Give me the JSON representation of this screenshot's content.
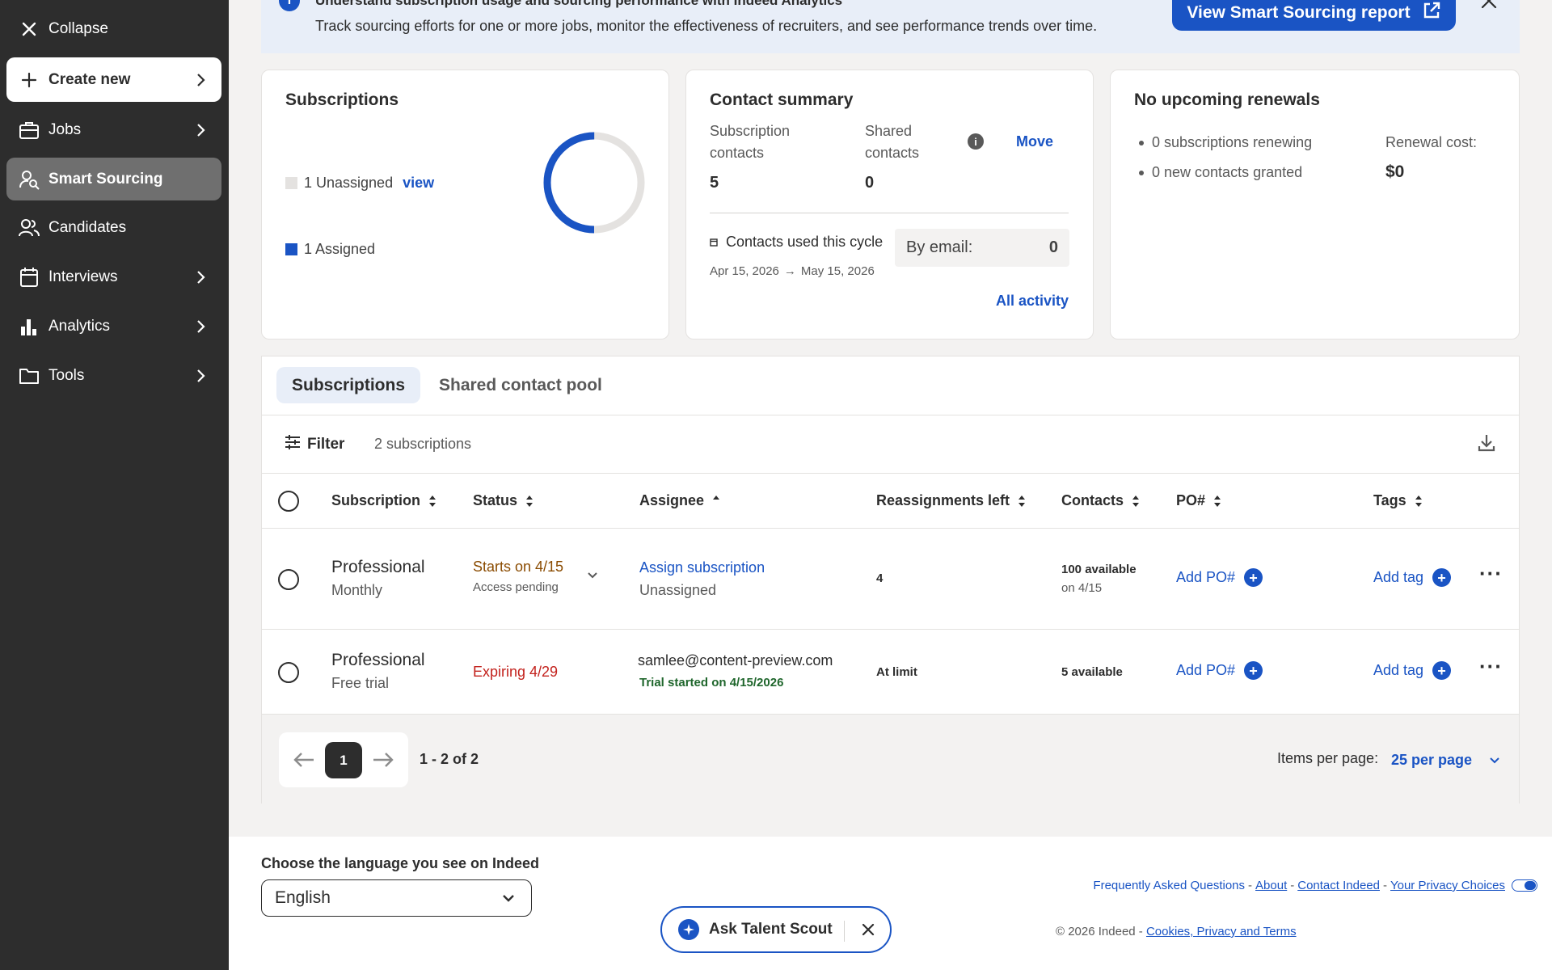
{
  "sidebar": {
    "collapse_label": "Collapse",
    "create_label": "Create new",
    "items": [
      {
        "label": "Jobs",
        "icon": "briefcase-icon"
      },
      {
        "label": "Smart Sourcing",
        "icon": "person-search-icon"
      },
      {
        "label": "Candidates",
        "icon": "people-icon"
      },
      {
        "label": "Interviews",
        "icon": "calendar-icon"
      },
      {
        "label": "Analytics",
        "icon": "bar-chart-icon"
      },
      {
        "label": "Tools",
        "icon": "folder-icon"
      }
    ]
  },
  "banner": {
    "title": "Understand subscription usage and sourcing performance with Indeed Analytics",
    "text": "Track sourcing efforts for one or more jobs, monitor the effectiveness of recruiters, and see performance trends over time.",
    "button_label": "View Smart Sourcing report"
  },
  "subscriptions_card": {
    "title": "Subscriptions",
    "unassigned": "1 Unassigned",
    "view_link": "view",
    "assigned": "1 Assigned",
    "assigned_count": 1,
    "unassigned_count": 1,
    "colors": {
      "assigned": "#1a54c4",
      "unassigned": "#e4e2e0"
    }
  },
  "contact_summary": {
    "title": "Contact summary",
    "subscription_contacts_label": "Subscription contacts",
    "subscription_contacts_value": "5",
    "shared_contacts_label": "Shared contacts",
    "shared_contacts_value": "0",
    "move_label": "Move",
    "cycle_label": "Contacts used this cycle",
    "cycle_start": "Apr 15, 2026",
    "cycle_end": "May 15, 2026",
    "by_email_label": "By email:",
    "by_email_value": "0",
    "all_activity": "All activity"
  },
  "renewals": {
    "title": "No upcoming renewals",
    "bullet1": "0 subscriptions renewing",
    "bullet2": "0 new contacts granted",
    "cost_label": "Renewal cost:",
    "cost_value": "$0"
  },
  "tabs": [
    "Subscriptions",
    "Shared contact pool"
  ],
  "toolbar": {
    "filter_label": "Filter",
    "count": "2 subscriptions"
  },
  "table": {
    "columns": [
      "Subscription",
      "Status",
      "Assignee",
      "Reassignments left",
      "Contacts",
      "PO#",
      "Tags"
    ],
    "rows": [
      {
        "plan": "Professional",
        "plan_sub": "Monthly",
        "status": "Starts on 4/15",
        "status_sub": "Access pending",
        "assignee": "Assign subscription",
        "assignee_sub": "Unassigned",
        "reassignments": "4",
        "contacts": "100 available",
        "contacts_sub": "on 4/15",
        "po": "Add PO#",
        "tag": "Add tag"
      },
      {
        "plan": "Professional",
        "plan_sub": "Free trial",
        "status": "Expiring 4/29",
        "assignee": "samlee@content-preview.com",
        "assignee_sub": "Trial started on 4/15/2026",
        "reassignments": "At limit",
        "contacts": "5 available",
        "po": "Add PO#",
        "tag": "Add tag"
      }
    ]
  },
  "pagination": {
    "page": "1",
    "range": "1 - 2 of 2",
    "ipp_label": "Items per page:",
    "ipp_value": "25 per page"
  },
  "footer": {
    "lang_label": "Choose the language you see on Indeed",
    "lang_value": "English",
    "scout_label": "Ask Talent Scout",
    "links": {
      "faq": "Frequently Asked Questions",
      "about": "About",
      "contact": "Contact Indeed",
      "privacy": "Your Privacy Choices"
    },
    "copyright": "© 2026 Indeed - ",
    "cookies": "Cookies, Privacy and Terms"
  },
  "colors": {
    "accent": "#1a54c4",
    "status_pending": "#8a4b00",
    "status_expiring": "#c3221d",
    "trial_green": "#1f662c",
    "sidebar_bg": "#2d2d2d"
  }
}
